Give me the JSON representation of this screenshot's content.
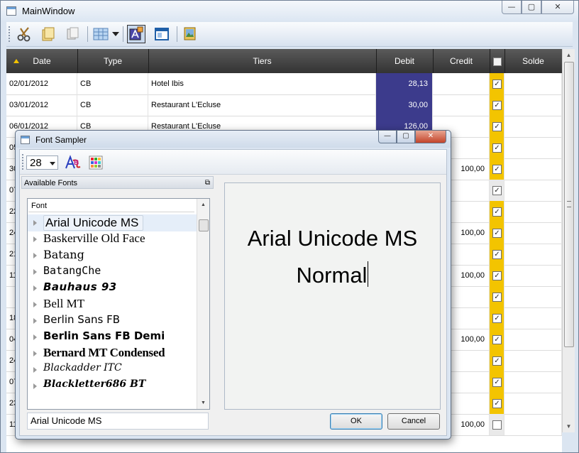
{
  "window": {
    "title": "MainWindow",
    "min": "—",
    "max": "▢",
    "close": "✕"
  },
  "toolbar": {
    "icons": [
      "scissors-icon",
      "folder-icon",
      "copy-icon",
      "grid-view-icon",
      "dropdown-arrow-icon",
      "font-sampler-icon",
      "window-icon",
      "image-icon"
    ]
  },
  "grid": {
    "columns": [
      "Date",
      "Type",
      "Tiers",
      "Debit",
      "Credit",
      "",
      "Solde"
    ],
    "rows": [
      {
        "date": "02/01/2012",
        "type": "CB",
        "tiers": "Hotel Ibis",
        "debit": "28,13",
        "credit": "",
        "checked": true,
        "solde": ""
      },
      {
        "date": "03/01/2012",
        "type": "CB",
        "tiers": "Restaurant L'Ecluse",
        "debit": "30,00",
        "credit": "",
        "checked": true,
        "solde": ""
      },
      {
        "date": "06/01/2012",
        "type": "CB",
        "tiers": "Restaurant L'Ecluse",
        "debit": "126,00",
        "credit": "",
        "checked": true,
        "solde": ""
      },
      {
        "date": "05",
        "type": "",
        "tiers": "",
        "debit": "",
        "credit": "",
        "checked": true,
        "solde": ""
      },
      {
        "date": "30",
        "type": "",
        "tiers": "",
        "debit": "",
        "credit": "100,00",
        "checked": true,
        "solde": ""
      },
      {
        "date": "07",
        "type": "",
        "tiers": "",
        "debit": "",
        "credit": "",
        "checked": true,
        "solde": ""
      },
      {
        "date": "22",
        "type": "",
        "tiers": "",
        "debit": "",
        "credit": "",
        "checked": true,
        "solde": ""
      },
      {
        "date": "24",
        "type": "",
        "tiers": "",
        "debit": "",
        "credit": "100,00",
        "checked": true,
        "solde": ""
      },
      {
        "date": "21",
        "type": "",
        "tiers": "",
        "debit": "",
        "credit": "",
        "checked": true,
        "solde": ""
      },
      {
        "date": "11",
        "type": "",
        "tiers": "",
        "debit": "",
        "credit": "100,00",
        "checked": true,
        "solde": ""
      },
      {
        "date": "",
        "type": "",
        "tiers": "",
        "debit": "",
        "credit": "",
        "checked": true,
        "solde": ""
      },
      {
        "date": "18",
        "type": "",
        "tiers": "",
        "debit": "",
        "credit": "",
        "checked": true,
        "solde": ""
      },
      {
        "date": "04",
        "type": "",
        "tiers": "",
        "debit": "",
        "credit": "100,00",
        "checked": true,
        "solde": ""
      },
      {
        "date": "24",
        "type": "",
        "tiers": "",
        "debit": "",
        "credit": "",
        "checked": true,
        "solde": ""
      },
      {
        "date": "07",
        "type": "",
        "tiers": "",
        "debit": "",
        "credit": "",
        "checked": true,
        "solde": ""
      },
      {
        "date": "23",
        "type": "",
        "tiers": "",
        "debit": "",
        "credit": "",
        "checked": true,
        "solde": ""
      },
      {
        "date": "11",
        "type": "",
        "tiers": "",
        "debit": "",
        "credit": "100,00",
        "checked": false,
        "solde": ""
      }
    ],
    "colors": {
      "debit_bg": "#3c3b8c",
      "check_bg": "#f3c400",
      "sort_arrow": "#f2c200"
    }
  },
  "dialog": {
    "title": "Font Sampler",
    "font_size": "28",
    "panel_title": "Available Fonts",
    "list_header": "Font",
    "fonts": [
      "Arial Unicode MS",
      "Baskerville Old Face",
      "Batang",
      "BatangChe",
      "Bauhaus 93",
      "Bell MT",
      "Berlin Sans FB",
      "Berlin Sans FB Demi",
      "Bernard MT Condensed",
      "Blackadder ITC",
      "Blackletter686 BT"
    ],
    "selected_font": "Arial Unicode MS",
    "preview_line1": "Arial Unicode MS",
    "preview_line2": "Normal",
    "ok_label": "OK",
    "cancel_label": "Cancel"
  }
}
